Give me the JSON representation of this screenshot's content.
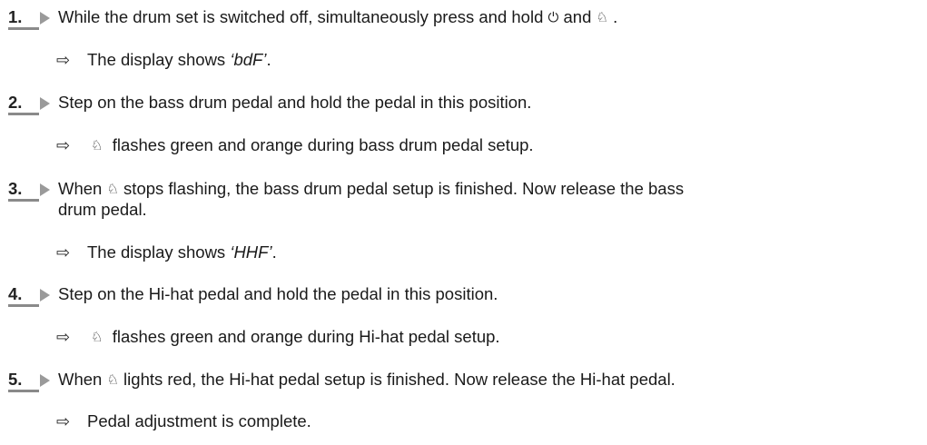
{
  "steps": [
    {
      "number": "1.",
      "text_before": "While the drum set is switched off, simultaneously press and hold ",
      "power_icon": "⏻",
      "text_mid": " and ",
      "pedal_icon": "♘",
      "text_after": " .",
      "result": {
        "arrow": "⇨",
        "text_before": "The display shows ",
        "emph": "‘bdF’",
        "text_after": "."
      }
    },
    {
      "number": "2.",
      "text": "Step on the bass drum pedal and hold the pedal in this position.",
      "result": {
        "arrow": "⇨",
        "icon": "♘",
        "text": "flashes green and orange during bass drum pedal setup."
      }
    },
    {
      "number": "3.",
      "text_before": "When ",
      "icon": "♘",
      "text_after": " stops flashing, the bass drum pedal setup is finished. Now release the bass",
      "text_line2": "drum pedal.",
      "result": {
        "arrow": "⇨",
        "text_before": "The display shows ",
        "emph": "‘HHF’",
        "text_after": "."
      }
    },
    {
      "number": "4.",
      "text": "Step on the Hi-hat pedal and hold the pedal in this position.",
      "result": {
        "arrow": "⇨",
        "icon": "♘",
        "text": "flashes green and orange during Hi-hat pedal setup."
      }
    },
    {
      "number": "5.",
      "text_before": "When ",
      "icon": "♘",
      "text_after": " lights red, the Hi-hat pedal setup is finished. Now release the Hi-hat pedal.",
      "result": {
        "arrow": "⇨",
        "text": "Pedal adjustment is complete."
      }
    }
  ]
}
